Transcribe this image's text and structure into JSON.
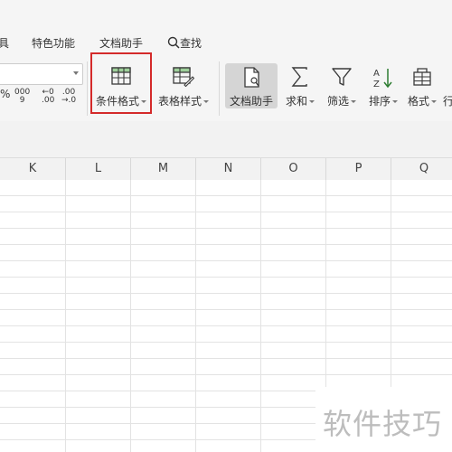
{
  "menu": {
    "partial_item": "具",
    "items": [
      "特色功能",
      "文档助手"
    ],
    "search_label": "查找"
  },
  "ribbon": {
    "number_formats": {
      "percent": "%",
      "thousands": "000",
      "thousands_sub": "9",
      "increase_decimal_top": "←0",
      "increase_decimal_bottom": ".00",
      "decrease_decimal_top": ".00",
      "decrease_decimal_bottom": "→.0"
    },
    "conditional_format_label": "条件格式",
    "table_style_label": "表格样式",
    "doc_assistant_label": "文档助手",
    "sum_label": "求和",
    "filter_label": "筛选",
    "sort_label": "排序",
    "format_label": "格式",
    "partial_label": "行",
    "accent_highlight": "#d42a2a"
  },
  "sheet": {
    "columns": [
      "K",
      "L",
      "M",
      "N",
      "O",
      "P",
      "Q"
    ]
  },
  "watermark": {
    "text": "软件技巧"
  }
}
